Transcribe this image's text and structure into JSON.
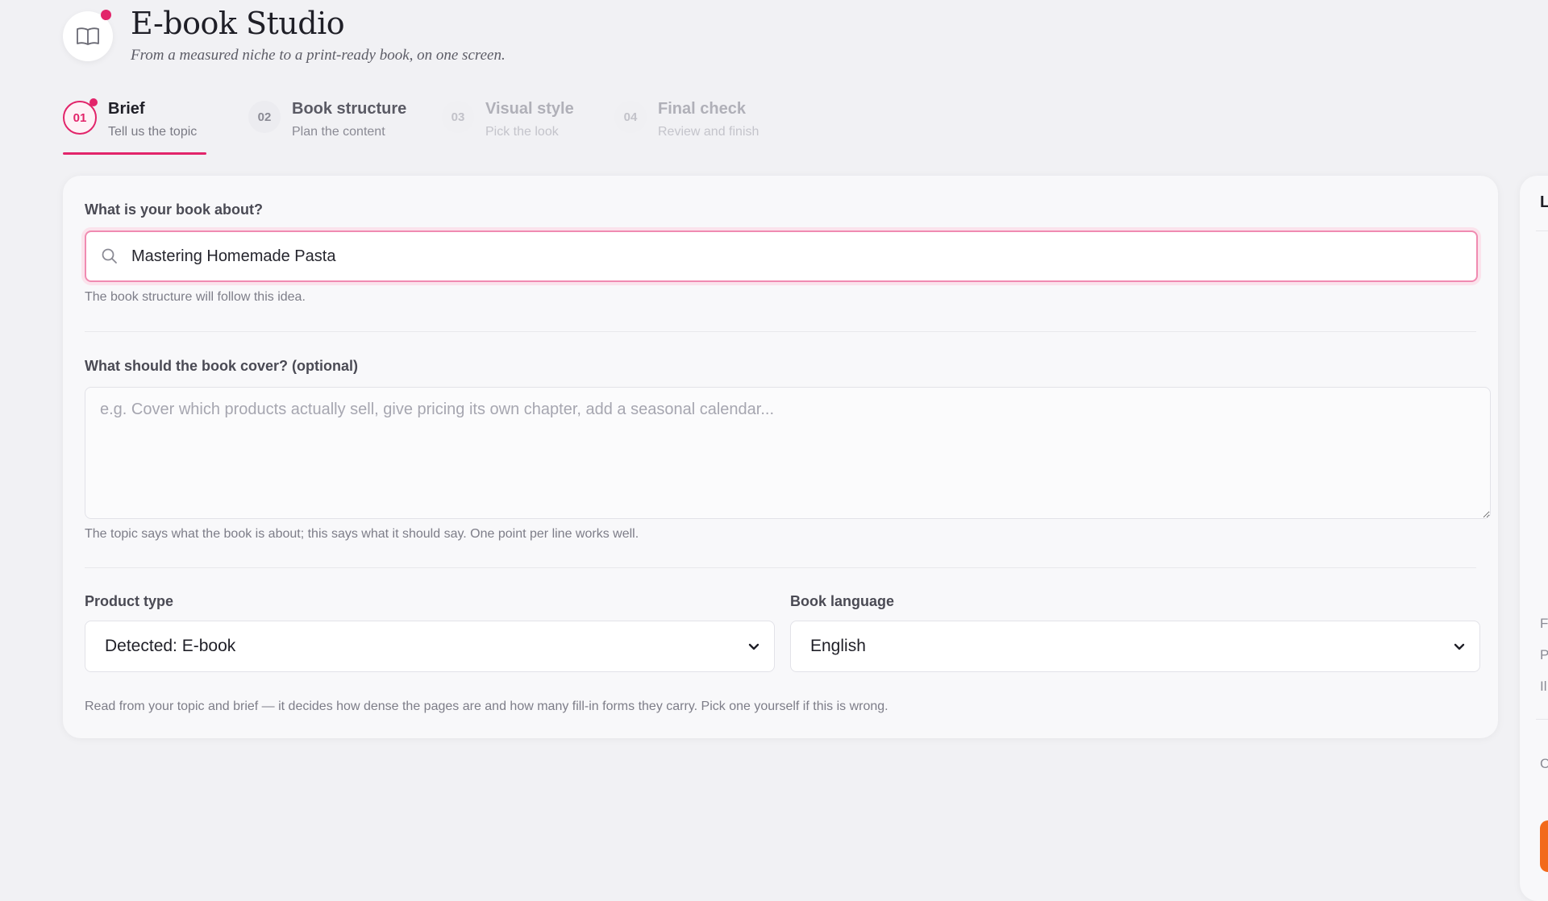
{
  "header": {
    "title": "E-book Studio",
    "subtitle": "From a measured niche to a print-ready book, on one screen."
  },
  "steps": [
    {
      "num": "01",
      "title": "Brief",
      "subtitle": "Tell us the topic",
      "state": "active"
    },
    {
      "num": "02",
      "title": "Book structure",
      "subtitle": "Plan the content",
      "state": "next"
    },
    {
      "num": "03",
      "title": "Visual style",
      "subtitle": "Pick the look",
      "state": "disabled"
    },
    {
      "num": "04",
      "title": "Final check",
      "subtitle": "Review and finish",
      "state": "disabled"
    }
  ],
  "topic": {
    "label": "What is your book about?",
    "value": "Mastering Homemade Pasta",
    "help": "The book structure will follow this idea."
  },
  "brief": {
    "label": "What should the book cover? (optional)",
    "placeholder": "e.g. Cover which products actually sell, give pricing its own chapter, add a seasonal calendar...",
    "help": "The topic says what the book is about; this says what it should say. One point per line works well."
  },
  "product_type": {
    "label": "Product type",
    "value": "Detected: E-book"
  },
  "language": {
    "label": "Book language",
    "value": "English"
  },
  "selects_help": "Read from your topic and brief — it decides how dense the pages are and how many fill-in forms they carry. Pick one yourself if this is wrong.",
  "side_panel": {
    "title": "L",
    "items": [
      "F",
      "P",
      "Il",
      "C"
    ]
  },
  "colors": {
    "accent": "#e2246a",
    "background": "#f1f1f4",
    "card": "#f8f8fa",
    "cta": "#f26a1b"
  }
}
